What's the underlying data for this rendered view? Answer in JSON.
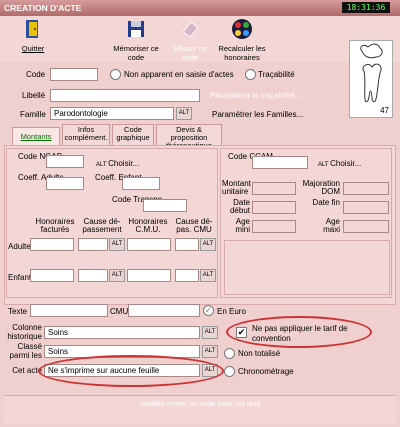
{
  "window": {
    "title": "CREATION D'ACTE",
    "clock": "18:31:36"
  },
  "toolbar": {
    "quit": "Quitter",
    "memorize": "Mémoriser ce code",
    "erase": "Effacer ce code",
    "recalc": "Recalculer les honoraires"
  },
  "form": {
    "code_label": "Code",
    "code_value": "",
    "non_apparent": "Non apparent en saisie d'actes",
    "tracabilite": "Traçabilité",
    "libelle_label": "Libellé",
    "libelle_value": "",
    "param_trac": "Paramétrer la traçabilité...",
    "famille_label": "Famille",
    "famille_value": "Parodontologie",
    "param_fam": "Paramétrer les Familles...",
    "tooth_number": "47"
  },
  "tabs": [
    {
      "label": "Montants"
    },
    {
      "label": "Infos complément."
    },
    {
      "label": "Code graphique"
    },
    {
      "label": "Devis & proposition thérapeutique"
    }
  ],
  "montants": {
    "code_ngap": "Code NGAP",
    "choisir": "Choisir...",
    "coeff_adulte": "Coeff. Adulte",
    "coeff_enfant": "Coeff. Enfant",
    "code_transpo": "Code Transpo",
    "col1": "Honoraires facturés",
    "col2": "Cause dé- passement",
    "col3": "Honoraires C.M.U.",
    "col4": "Cause dé- pas. CMU",
    "adulte": "Adulte",
    "enfant": "Enfant",
    "code_ccam": "Code CCAM",
    "choisir2": "Choisir...",
    "montant_unitaire": "Montant unitaire",
    "majoration_dom": "Majoration DOM",
    "date_debut": "Date début",
    "date_fin": "Date fin",
    "age_mini": "Age mini",
    "age_maxi": "Age maxi"
  },
  "bottom": {
    "texte": "Texte",
    "cmu": "CMU",
    "en_euro": "En Euro",
    "colonne_historique": "Colonne historique",
    "colonne_value": "Soins",
    "classe_parmi": "Classé parmi les",
    "classe_value": "Soins",
    "cet_acte": "Cet acte",
    "cet_acte_value": "Ne s'imprime sur aucune feuille",
    "ne_pas_appliquer": "Ne pas appliquer le tarif de convention",
    "non_totalise": "Non totalisé",
    "chronometrage": "Chronométrage"
  },
  "status": {
    "text": "Veuillez entrer un code pour cet acte"
  }
}
